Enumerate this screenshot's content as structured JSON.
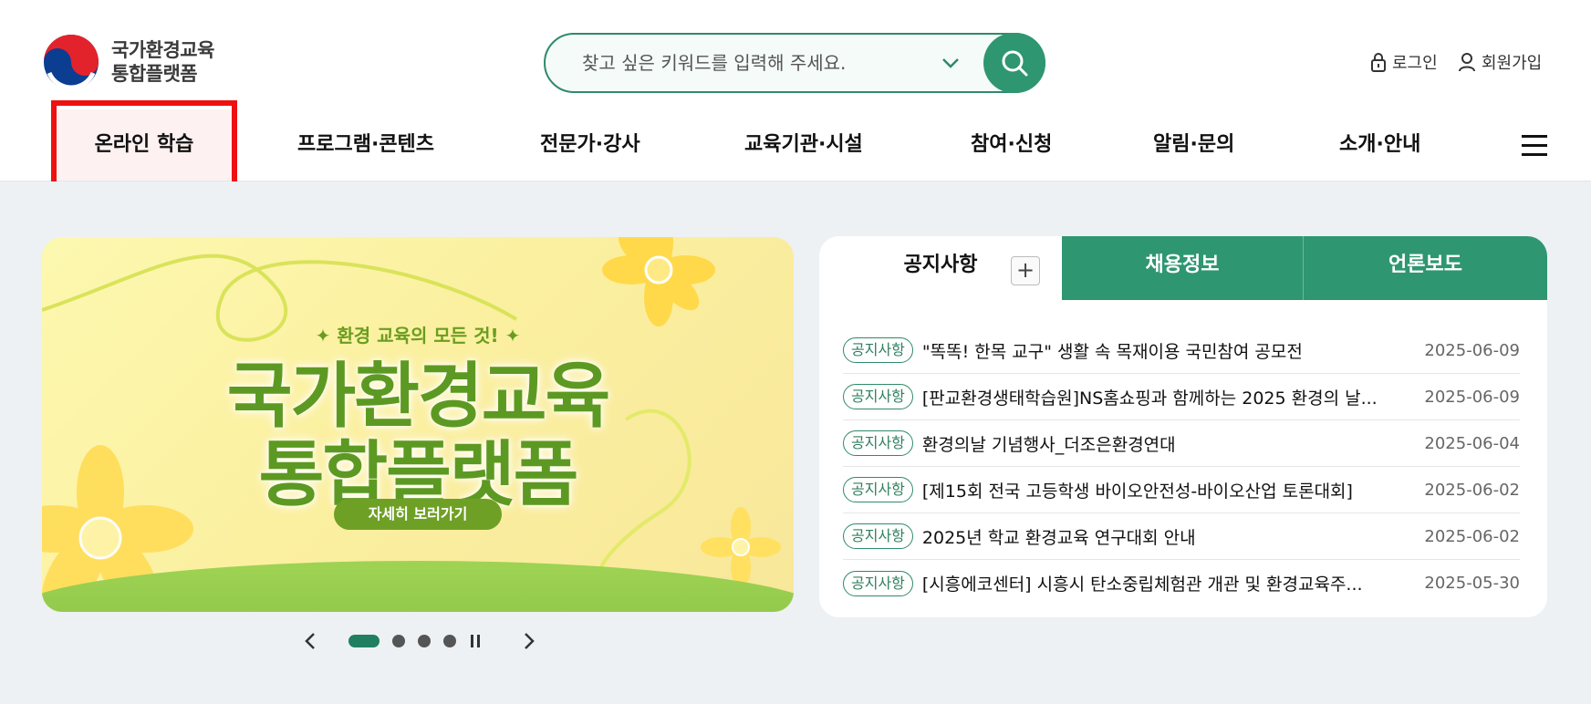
{
  "header": {
    "logo_line1": "국가환경교육",
    "logo_line2": "통합플랫폼",
    "search_placeholder": "찾고 싶은 키워드를 입력해 주세요.",
    "login_label": "로그인",
    "join_label": "회원가입"
  },
  "nav": {
    "items": [
      "온라인 학습",
      "프로그램·콘텐츠",
      "전문가·강사",
      "교육기관·시설",
      "참여·신청",
      "알림·문의",
      "소개·안내"
    ],
    "active_index": 0
  },
  "banner": {
    "subtitle": "✦ 환경 교육의 모든 것! ✦",
    "title_line1": "국가환경교육",
    "title_line2": "통합플랫폼",
    "button_label": "자세히 보러가기",
    "slide_count": 4,
    "active_slide": 0
  },
  "board": {
    "tabs": [
      "공지사항",
      "채용정보",
      "언론보도"
    ],
    "active_tab": 0,
    "badge_label": "공지사항",
    "rows": [
      {
        "title": "\"똑똑! 한목 교구\" 생활 속 목재이용 국민참여 공모전",
        "date": "2025-06-09"
      },
      {
        "title": "[판교환경생태학습원]NS홈쇼핑과 함께하는 2025 환경의 날...",
        "date": "2025-06-09"
      },
      {
        "title": "환경의날 기념행사_더조은환경연대",
        "date": "2025-06-04"
      },
      {
        "title": "[제15회 전국 고등학생 바이오안전성-바이오산업 토론대회]",
        "date": "2025-06-02"
      },
      {
        "title": "2025년 학교 환경교육 연구대회 안내",
        "date": "2025-06-02"
      },
      {
        "title": "[시흥에코센터] 시흥시 탄소중립체험관 개관 및 환경교육주...",
        "date": "2025-05-30"
      }
    ]
  },
  "colors": {
    "brand_green": "#2f9672",
    "highlight_red": "#ee1111",
    "banner_green": "#5c9922"
  }
}
